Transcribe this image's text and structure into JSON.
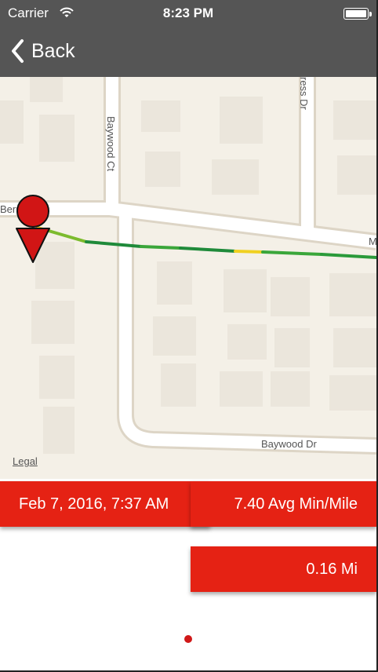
{
  "statusbar": {
    "carrier": "Carrier",
    "time": "8:23 PM",
    "icons": [
      "wifi-icon",
      "battery-icon"
    ]
  },
  "navbar": {
    "back_label": "Back",
    "back_icon": "chevron-left-icon"
  },
  "map": {
    "streets": [
      "Baywood Ct",
      "Baywood Dr",
      "Berri",
      "ress Dr",
      "M"
    ],
    "legal_label": "Legal",
    "route_colors": [
      "#3aa63a",
      "#f0d020",
      "#1f8a3a"
    ],
    "marker_color": "#d11515"
  },
  "run": {
    "date": "Feb 7, 2016, 7:37 AM",
    "pace": "7.40 Avg Min/Mile",
    "distance": "0.16 Mi"
  },
  "pager": {
    "accent_color": "#d01818"
  }
}
